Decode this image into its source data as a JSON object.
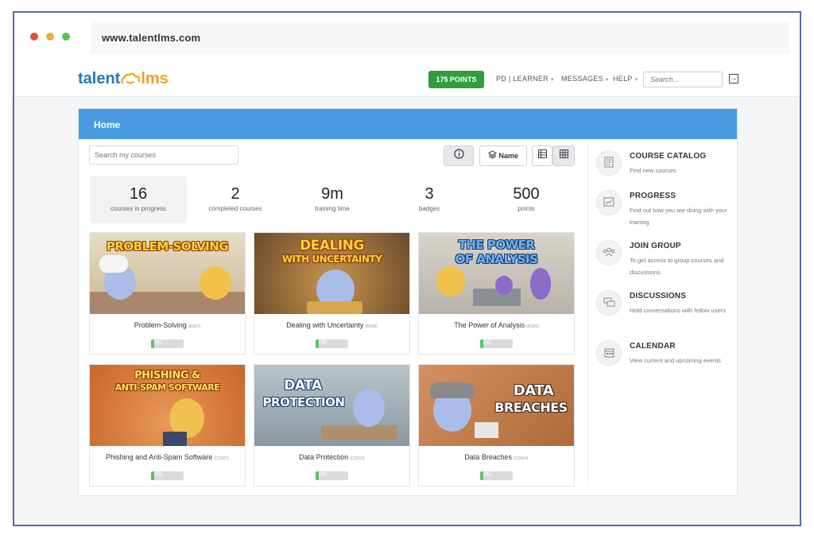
{
  "browser": {
    "url": "www.talentlms.com"
  },
  "header": {
    "logo_left": "talent",
    "logo_right": "lms",
    "points": "175 POINTS",
    "nav": [
      {
        "label": "PD | LEARNER"
      },
      {
        "label": "MESSAGES"
      },
      {
        "label": "HELP"
      }
    ],
    "search_placeholder": "Search..."
  },
  "home": {
    "title": "Home",
    "search_placeholder": "Search my courses",
    "sort_label": "Name"
  },
  "stats": [
    {
      "value": "16",
      "label": "courses in progress"
    },
    {
      "value": "2",
      "label": "completed courses"
    },
    {
      "value": "9m",
      "label": "training time"
    },
    {
      "value": "3",
      "label": "badges"
    },
    {
      "value": "500",
      "label": "points"
    }
  ],
  "courses": [
    {
      "name": "Problem-Solving",
      "code": "(BS07)",
      "image_title": "PROBLEM-SOLVING",
      "progress": "0%",
      "progress_value": 0,
      "colors": {
        "bg1": "#c9b89a",
        "bg2": "#e8dcc4",
        "accent": "#9a7550"
      }
    },
    {
      "name": "Dealing with Uncertainty",
      "code": "(BS08)",
      "image_title_1": "DEALING",
      "image_title_2": "WITH UNCERTAINTY",
      "progress": "0%",
      "progress_value": 0,
      "colors": {
        "bg1": "#6a4a2a",
        "bg2": "#a5784a",
        "accent": "#d9a64b"
      }
    },
    {
      "name": "The Power of Analysis",
      "code": "(BS05)",
      "image_title_1": "THE POWER",
      "image_title_2": "OF ANALYSIS",
      "progress": "0%",
      "progress_value": 0,
      "colors": {
        "bg1": "#b8b2a8",
        "bg2": "#d9d4ca",
        "accent": "#4a90d0"
      }
    },
    {
      "name": "Phishing and Anti-Spam Software",
      "code": "(CS007)",
      "image_title_1": "PHISHING &",
      "image_title_2": "ANTI-SPAM SOFTWARE",
      "progress": "0%",
      "progress_value": 0,
      "colors": {
        "bg1": "#c8662a",
        "bg2": "#e89a55",
        "accent": "#f0c050"
      }
    },
    {
      "name": "Data Protection",
      "code": "(CS013)",
      "image_title_1": "DATA",
      "image_title_2": "PROTECTION",
      "progress": "0%",
      "progress_value": 0,
      "colors": {
        "bg1": "#8a9aa5",
        "bg2": "#b8c4c8",
        "accent": "#3a7bc8"
      }
    },
    {
      "name": "Data Breaches",
      "code": "(CS014)",
      "image_title_1": "DATA",
      "image_title_2": "BREACHES",
      "progress": "0%",
      "progress_value": 0,
      "colors": {
        "bg1": "#b06a3a",
        "bg2": "#d49060",
        "accent": "#ffffff"
      }
    }
  ],
  "sidebar": [
    {
      "title": "COURSE CATALOG",
      "desc": "Find new courses",
      "icon": "catalog-icon"
    },
    {
      "title": "PROGRESS",
      "desc": "Find out how you are doing with your training",
      "icon": "progress-icon"
    },
    {
      "title": "JOIN GROUP",
      "desc": "To get access to group courses and discussions",
      "icon": "group-icon"
    },
    {
      "title": "DISCUSSIONS",
      "desc": "Hold conversations with fellow users",
      "icon": "discussions-icon"
    },
    {
      "title": "CALENDAR",
      "desc": "View current and upcoming events",
      "icon": "calendar-icon"
    }
  ],
  "colors": {
    "home_bar": "#4a9ae2",
    "points_green": "#2f9e3c",
    "progress_green": "#5bc36a",
    "logo_blue": "#2b72c2",
    "logo_orange": "#f0a020"
  }
}
